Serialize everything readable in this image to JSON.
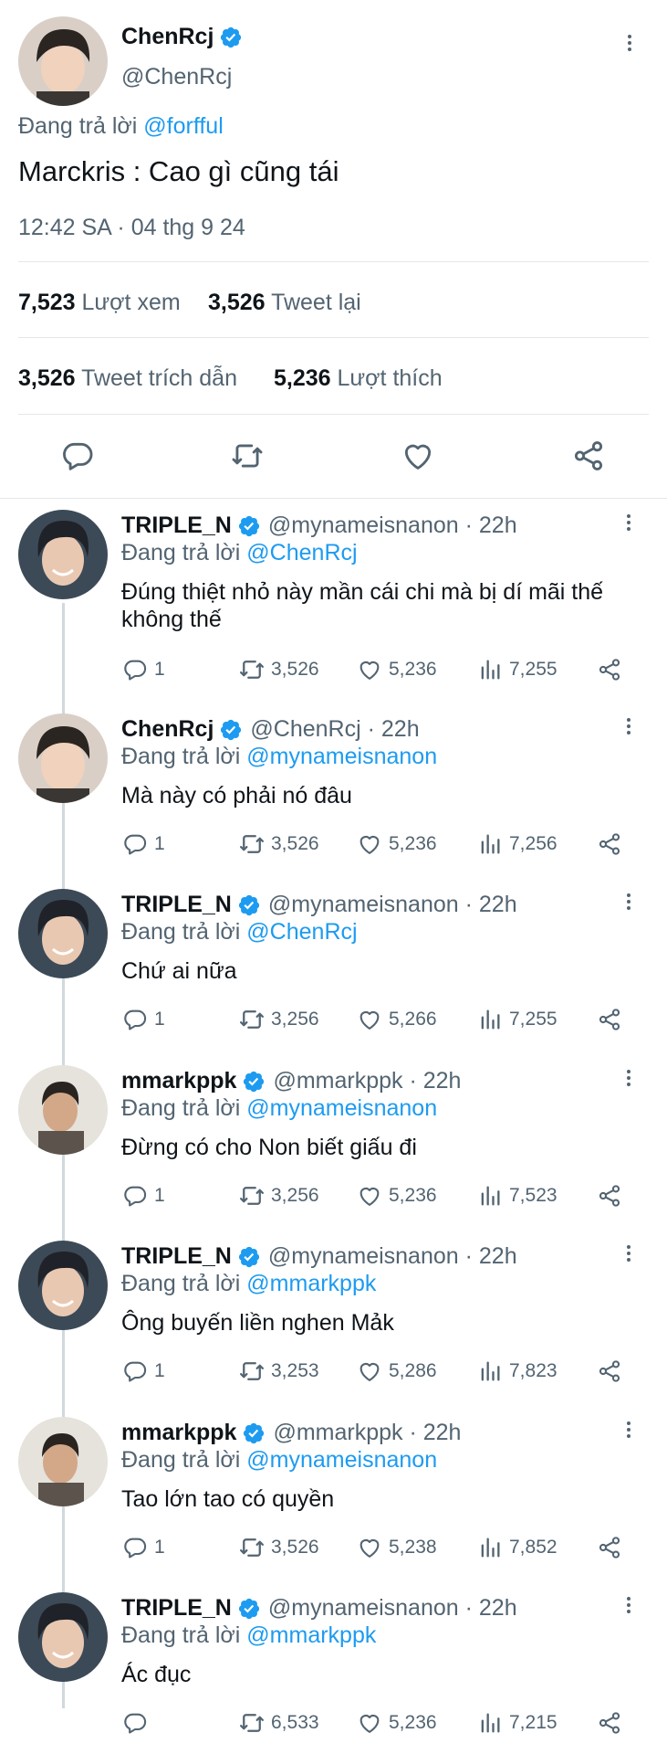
{
  "main_tweet": {
    "display_name": "ChenRcj",
    "handle": "@ChenRcj",
    "replying_prefix": "Đang trả lời",
    "replying_to": "@forfful",
    "text": "Marckris : Cao gì cũng tái",
    "timestamp": "12:42 SA · 04 thg 9 24",
    "views_count": "7,523",
    "views_label": "Lượt xem",
    "retweets_count": "3,526",
    "retweets_label": "Tweet lại",
    "quotes_count": "3,526",
    "quotes_label": "Tweet trích dẫn",
    "likes_count": "5,236",
    "likes_label": "Lượt thích"
  },
  "icons": {
    "verified": "verified-badge-icon",
    "more": "more-vertical-icon",
    "reply": "reply-bubble-icon",
    "retweet": "retweet-icon",
    "like": "heart-icon",
    "share": "share-icon",
    "views": "views-bar-chart-icon"
  },
  "colors": {
    "accent": "#1d9bf0",
    "text_primary": "#0f1419",
    "text_secondary": "#536471",
    "divider": "#e4e7ea"
  },
  "replies": [
    {
      "display_name": "TRIPLE_N",
      "handle": "@mynameisnanon",
      "time": "22h",
      "replying_prefix": "Đang trả lời",
      "replying_to": "@ChenRcj",
      "text": "Đúng thiệt nhỏ này mần cái chi mà bị dí mãi thế không thế",
      "reply_count": "1",
      "retweet_count": "3,526",
      "like_count": "5,236",
      "view_count": "7,255"
    },
    {
      "display_name": "ChenRcj",
      "handle": "@ChenRcj",
      "time": "22h",
      "replying_prefix": "Đang trả lời",
      "replying_to": "@mynameisnanon",
      "text": "Mà này có phải nó đâu",
      "reply_count": "1",
      "retweet_count": "3,526",
      "like_count": "5,236",
      "view_count": "7,256"
    },
    {
      "display_name": "TRIPLE_N",
      "handle": "@mynameisnanon",
      "time": "22h",
      "replying_prefix": "Đang trả lời",
      "replying_to": "@ChenRcj",
      "text": "Chứ ai nữa",
      "reply_count": "1",
      "retweet_count": "3,256",
      "like_count": "5,266",
      "view_count": "7,255"
    },
    {
      "display_name": "mmarkppk",
      "handle": "@mmarkppk",
      "time": "22h",
      "replying_prefix": "Đang trả lời",
      "replying_to": "@mynameisnanon",
      "text": "Đừng có cho Non biết giấu đi",
      "reply_count": "1",
      "retweet_count": "3,256",
      "like_count": "5,236",
      "view_count": "7,523"
    },
    {
      "display_name": "TRIPLE_N",
      "handle": "@mynameisnanon",
      "time": "22h",
      "replying_prefix": "Đang trả lời",
      "replying_to": "@mmarkppk",
      "text": "Ông buyến liền nghen Mảk",
      "reply_count": "1",
      "retweet_count": "3,253",
      "like_count": "5,286",
      "view_count": "7,823"
    },
    {
      "display_name": "mmarkppk",
      "handle": "@mmarkppk",
      "time": "22h",
      "replying_prefix": "Đang trả lời",
      "replying_to": "@mynameisnanon",
      "text": "Tao lớn tao có quyền",
      "reply_count": "1",
      "retweet_count": "3,526",
      "like_count": "5,238",
      "view_count": "7,852"
    },
    {
      "display_name": "TRIPLE_N",
      "handle": "@mynameisnanon",
      "time": "22h",
      "replying_prefix": "Đang trả lời",
      "replying_to": "@mmarkppk",
      "text": "Ác đục",
      "reply_count": "",
      "retweet_count": "6,533",
      "like_count": "5,236",
      "view_count": "7,215"
    }
  ]
}
